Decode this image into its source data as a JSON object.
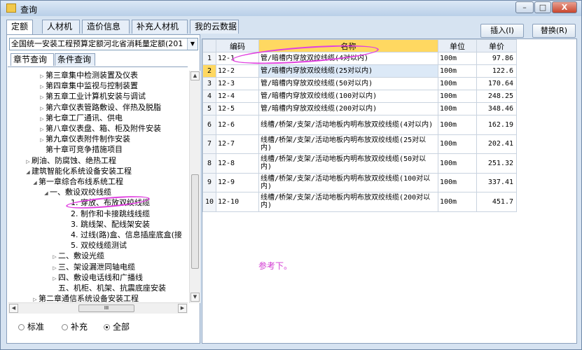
{
  "window": {
    "title": "查询",
    "minimize": "–",
    "maximize": "□",
    "close": "X"
  },
  "tabs": [
    "定额",
    "人材机",
    "造价信息",
    "补充人材机",
    "我的云数据"
  ],
  "toolbar": {
    "insert_label": "插入(I)",
    "replace_label": "替换(R)"
  },
  "left": {
    "combo_value": "全国统一安装工程预算定额河北省消耗量定额(201",
    "subtabs": [
      "章节查询",
      "条件查询"
    ],
    "tree": [
      {
        "label": "第三章集中检测装置及仪表",
        "exp": "▷"
      },
      {
        "label": "第四章集中监视与控制装置",
        "exp": "▷"
      },
      {
        "label": "第五章工业计算机安装与调试",
        "exp": "▷"
      },
      {
        "label": "第六章仪表管路敷设、伴热及脱脂",
        "exp": "▷"
      },
      {
        "label": "第七章工厂通讯、供电",
        "exp": "▷"
      },
      {
        "label": "第八章仪表盘、箱、柜及附件安装",
        "exp": "▷"
      },
      {
        "label": "第九章仪表附件制作安装",
        "exp": "▷"
      },
      {
        "label": "第十章可竞争措施项目",
        "exp": ""
      },
      {
        "label": "刷油、防腐蚀、绝热工程",
        "exp": "▷"
      },
      {
        "label": "建筑智能化系统设备安装工程",
        "exp": "◢"
      },
      {
        "label": "第一章综合布线系统工程",
        "exp": "◢"
      },
      {
        "label": "一、敷设双绞线缆",
        "exp": "◢"
      },
      {
        "label": "1. 穿放、布放双绞线缆",
        "exp": ""
      },
      {
        "label": "2. 制作和卡接跳线线缆",
        "exp": ""
      },
      {
        "label": "3. 跳线架、配线架安装",
        "exp": ""
      },
      {
        "label": "4. 过线(路)盒、信息插座底盒(接",
        "exp": ""
      },
      {
        "label": "5. 双绞线缆测试",
        "exp": ""
      },
      {
        "label": "二、敷设光缆",
        "exp": "▷"
      },
      {
        "label": "三、架设漏泄同轴电缆",
        "exp": "▷"
      },
      {
        "label": "四、敷设电话线和广播线",
        "exp": "▷"
      },
      {
        "label": "五、机柜、机架、抗震底座安装",
        "exp": ""
      },
      {
        "label": "第二章通信系统设备安装工程",
        "exp": "▷"
      }
    ],
    "hscroll_grip": "III",
    "radios": [
      {
        "label": "标准",
        "checked": false
      },
      {
        "label": "补充",
        "checked": false
      },
      {
        "label": "全部",
        "checked": true
      }
    ]
  },
  "table": {
    "headers": [
      "编码",
      "名称",
      "单位",
      "单价"
    ],
    "rows": [
      {
        "no": "1",
        "code": "12-1",
        "name": "管/暗槽内穿放双绞线缆(4对以内)",
        "unit": "100m",
        "price": "97.86"
      },
      {
        "no": "2",
        "code": "12-2",
        "name": "管/暗槽内穿放双绞线缆(25对以内)",
        "unit": "100m",
        "price": "122.6"
      },
      {
        "no": "3",
        "code": "12-3",
        "name": "管/暗槽内穿放双绞线缆(50对以内)",
        "unit": "100m",
        "price": "170.64"
      },
      {
        "no": "4",
        "code": "12-4",
        "name": "管/暗槽内穿放双绞线缆(100对以内)",
        "unit": "100m",
        "price": "248.25"
      },
      {
        "no": "5",
        "code": "12-5",
        "name": "管/暗槽内穿放双绞线缆(200对以内)",
        "unit": "100m",
        "price": "348.46"
      },
      {
        "no": "6",
        "code": "12-6",
        "name": "线槽/桥架/支架/活动地板内明布放双绞线缆(4对以内)",
        "unit": "100m",
        "price": "162.19"
      },
      {
        "no": "7",
        "code": "12-7",
        "name": "线槽/桥架/支架/活动地板内明布放双绞线缆(25对以内)",
        "unit": "100m",
        "price": "202.41"
      },
      {
        "no": "8",
        "code": "12-8",
        "name": "线槽/桥架/支架/活动地板内明布放双绞线缆(50对以内)",
        "unit": "100m",
        "price": "251.32"
      },
      {
        "no": "9",
        "code": "12-9",
        "name": "线槽/桥架/支架/活动地板内明布放双绞线缆(100对以内)",
        "unit": "100m",
        "price": "337.41"
      },
      {
        "no": "10",
        "code": "12-10",
        "name": "线槽/桥架/支架/活动地板内明布放双绞线缆(200对以内)",
        "unit": "100m",
        "price": "451.7"
      }
    ],
    "selected_row": 2
  },
  "annotation_note": "参考下。",
  "colors": {
    "header_highlight": "#ffd861",
    "annotation": "#e040e0"
  }
}
